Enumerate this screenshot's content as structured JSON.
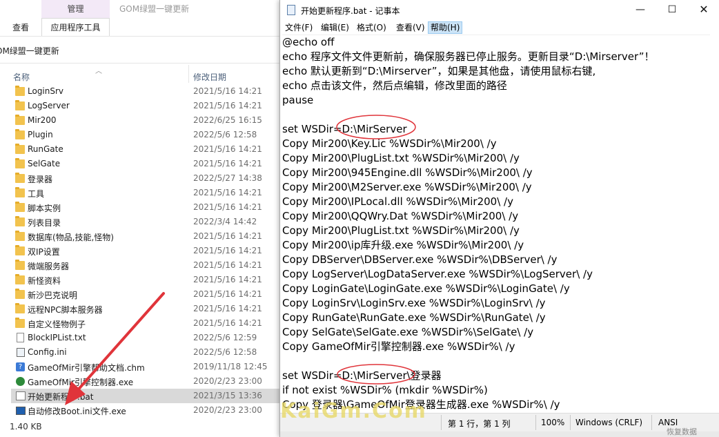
{
  "explorer": {
    "title": "GOM绿盟一键更新",
    "ribbon": {
      "context_group": "管理",
      "tabs": [
        "查看",
        "应用程序工具"
      ]
    },
    "address": "OM绿盟一键更新",
    "columns": {
      "name": "名称",
      "date": "修改日期"
    },
    "files": [
      {
        "name": "LoginSrv",
        "date": "2021/5/16 14:21",
        "type": "folder"
      },
      {
        "name": "LogServer",
        "date": "2021/5/16 14:21",
        "type": "folder"
      },
      {
        "name": "Mir200",
        "date": "2022/6/25 16:15",
        "type": "folder"
      },
      {
        "name": "Plugin",
        "date": "2022/5/6 12:58",
        "type": "folder"
      },
      {
        "name": "RunGate",
        "date": "2021/5/16 14:21",
        "type": "folder"
      },
      {
        "name": "SelGate",
        "date": "2021/5/16 14:21",
        "type": "folder"
      },
      {
        "name": "登录器",
        "date": "2022/5/27 14:38",
        "type": "folder"
      },
      {
        "name": "工具",
        "date": "2021/5/16 14:21",
        "type": "folder"
      },
      {
        "name": "脚本实例",
        "date": "2021/5/16 14:21",
        "type": "folder"
      },
      {
        "name": "列表目录",
        "date": "2022/3/4 14:42",
        "type": "folder"
      },
      {
        "name": "数据库(物品,技能,怪物)",
        "date": "2021/5/16 14:21",
        "type": "folder"
      },
      {
        "name": "双IP设置",
        "date": "2021/5/16 14:21",
        "type": "folder"
      },
      {
        "name": "微端服务器",
        "date": "2021/5/16 14:21",
        "type": "folder"
      },
      {
        "name": "新怪资料",
        "date": "2021/5/16 14:21",
        "type": "folder"
      },
      {
        "name": "新沙巴克说明",
        "date": "2021/5/16 14:21",
        "type": "folder"
      },
      {
        "name": "远程NPC脚本服务器",
        "date": "2021/5/16 14:21",
        "type": "folder"
      },
      {
        "name": "自定义怪物例子",
        "date": "2021/5/16 14:21",
        "type": "folder"
      },
      {
        "name": "BlockIPList.txt",
        "date": "2022/5/6 12:59",
        "type": "doc"
      },
      {
        "name": "Config.ini",
        "date": "2022/5/6 12:58",
        "type": "ini"
      },
      {
        "name": "GameOfMir引擎帮助文档.chm",
        "date": "2019/11/18 12:45",
        "type": "chm"
      },
      {
        "name": "GameOfMir引擎控制器.exe",
        "date": "2020/2/23 23:00",
        "type": "exe"
      },
      {
        "name": "开始更新程序.bat",
        "date": "2021/3/15 13:36",
        "type": "bat",
        "selected": true
      },
      {
        "name": "自动修改Boot.ini文件.exe",
        "date": "2020/2/23 23:00",
        "type": "exe2"
      }
    ],
    "status": "1.40 KB"
  },
  "notepad": {
    "title": "开始更新程序.bat - 记事本",
    "menus": [
      "文件(F)",
      "编辑(E)",
      "格式(O)",
      "查看(V)",
      "帮助(H)"
    ],
    "lines": [
      "@echo off",
      "echo 程序文件文件更新前，确保服务器已停止服务。更新目录“D:\\Mirserver”！",
      "echo 默认更新到“D:\\Mirserver”，如果是其他盘，请使用鼠标右键,",
      "echo 点击该文件，然后点编辑，修改里面的路径",
      "pause",
      "",
      "set WSDir=D:\\MirServer",
      "Copy Mir200\\Key.Lic %WSDir%\\Mir200\\ /y",
      "Copy Mir200\\PlugList.txt %WSDir%\\Mir200\\ /y",
      "Copy Mir200\\945Engine.dll %WSDir%\\Mir200\\ /y",
      "Copy Mir200\\M2Server.exe %WSDir%\\Mir200\\ /y",
      "Copy Mir200\\IPLocal.dll %WSDir%\\Mir200\\ /y",
      "Copy Mir200\\QQWry.Dat %WSDir%\\Mir200\\ /y",
      "Copy Mir200\\PlugList.txt %WSDir%\\Mir200\\ /y",
      "Copy Mir200\\ip库升级.exe %WSDir%\\Mir200\\ /y",
      "Copy DBServer\\DBServer.exe %WSDir%\\DBServer\\ /y",
      "Copy LogServer\\LogDataServer.exe %WSDir%\\LogServer\\ /y",
      "Copy LoginGate\\LoginGate.exe %WSDir%\\LoginGate\\ /y",
      "Copy LoginSrv\\LoginSrv.exe %WSDir%\\LoginSrv\\ /y",
      "Copy RunGate\\RunGate.exe %WSDir%\\RunGate\\ /y",
      "Copy SelGate\\SelGate.exe %WSDir%\\SelGate\\ /y",
      "Copy GameOfMir引擎控制器.exe %WSDir%\\ /y",
      "",
      "set WSDir=D:\\MirServer\\登录器",
      "if not exist %WSDir% (mkdir %WSDir%)",
      "Copy 登录器\\GameOfMir登录器生成器.exe %WSDir%\\ /y"
    ],
    "status": {
      "position": "第 1 行，第 1 列",
      "zoom": "100%",
      "eol": "Windows (CRLF)",
      "encoding": "ANSI"
    },
    "watermark": "KaiGm.Com",
    "corner_text": "恢复数据"
  },
  "colors": {
    "annotation_red": "#e0343a",
    "selection": "#d9d9d9",
    "context_tab": "#f3e9f7"
  }
}
